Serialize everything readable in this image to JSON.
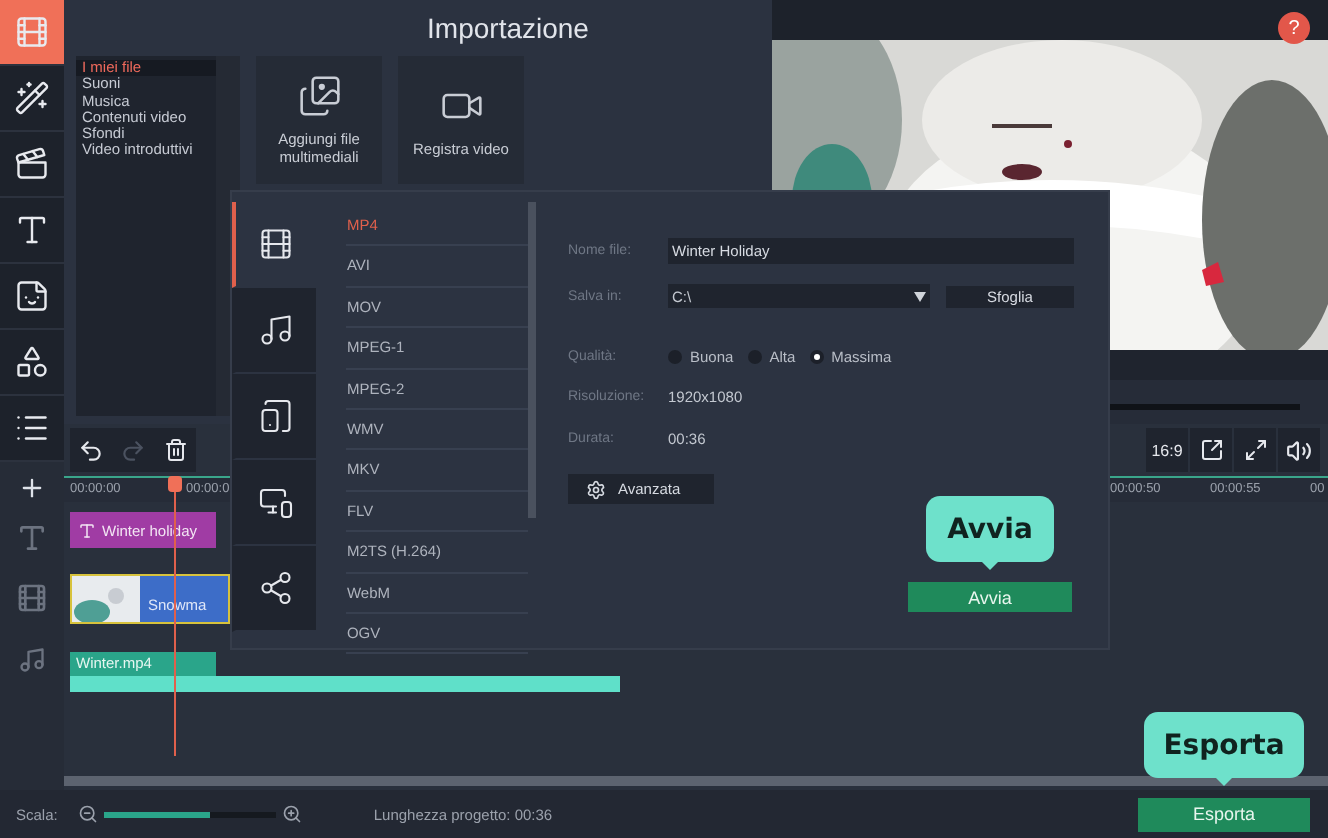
{
  "sidebar": {
    "tools": [
      {
        "kind": "import",
        "selected": true
      },
      {
        "kind": "effects",
        "selected": false
      },
      {
        "kind": "transitions",
        "selected": false
      },
      {
        "kind": "titles",
        "selected": false
      },
      {
        "kind": "stickers",
        "selected": false
      },
      {
        "kind": "shapes",
        "selected": false
      },
      {
        "kind": "more",
        "selected": false
      }
    ]
  },
  "import_panel": {
    "title": "Importazione",
    "categories": [
      {
        "label": "I miei file",
        "selected": true
      },
      {
        "label": "Suoni",
        "selected": false
      },
      {
        "label": "Musica",
        "selected": false
      },
      {
        "label": "Contenuti video",
        "selected": false
      },
      {
        "label": "Sfondi",
        "selected": false
      },
      {
        "label": "Video introduttivi",
        "selected": false
      }
    ],
    "tiles": [
      {
        "kind": "media",
        "label": "Aggiungi file multimediali"
      },
      {
        "kind": "camera",
        "label": "Registra video"
      }
    ]
  },
  "preview": {
    "help": "?",
    "aspect": "16:9"
  },
  "timeline": {
    "ruler": [
      "00:00:00",
      "00:00:0",
      "00:00:50",
      "00:00:55",
      "00"
    ],
    "tracks": [
      {
        "kind": "text",
        "clip": "Winter holiday"
      },
      {
        "kind": "video",
        "clip": "Snowma"
      },
      {
        "kind": "audio",
        "clip": "Winter.mp4"
      }
    ]
  },
  "export_dialog": {
    "tabs": [
      {
        "kind": "video",
        "selected": true
      },
      {
        "kind": "audio",
        "selected": false
      },
      {
        "kind": "devices",
        "selected": false
      },
      {
        "kind": "tv",
        "selected": false
      },
      {
        "kind": "share",
        "selected": false
      }
    ],
    "formats": [
      {
        "label": "MP4",
        "selected": true
      },
      {
        "label": "AVI",
        "selected": false
      },
      {
        "label": "MOV",
        "selected": false
      },
      {
        "label": "MPEG-1",
        "selected": false
      },
      {
        "label": "MPEG-2",
        "selected": false
      },
      {
        "label": "WMV",
        "selected": false
      },
      {
        "label": "MKV",
        "selected": false
      },
      {
        "label": "FLV",
        "selected": false
      },
      {
        "label": "M2TS (H.264)",
        "selected": false
      },
      {
        "label": "WebM",
        "selected": false
      },
      {
        "label": "OGV",
        "selected": false
      }
    ],
    "file_name": {
      "label": "Nome file:",
      "value": "Winter Holiday"
    },
    "save_in": {
      "label": "Salva in:",
      "value": "C:\\",
      "browse": "Sfoglia"
    },
    "quality": {
      "label": "Qualità:",
      "options": [
        {
          "label": "Buona",
          "selected": false
        },
        {
          "label": "Alta",
          "selected": false
        },
        {
          "label": "Massima",
          "selected": true
        }
      ]
    },
    "resolution": {
      "label": "Risoluzione:",
      "value": "1920x1080"
    },
    "duration": {
      "label": "Durata:",
      "value": "00:36"
    },
    "advanced": "Avanzata",
    "start": "Avvia"
  },
  "callouts": [
    "Avvia",
    "Esporta"
  ],
  "status_bar": {
    "scale_label": "Scala:",
    "scale": {
      "level": 0.62
    },
    "project_length": "Lunghezza progetto: 00:36",
    "export": "Esporta"
  }
}
